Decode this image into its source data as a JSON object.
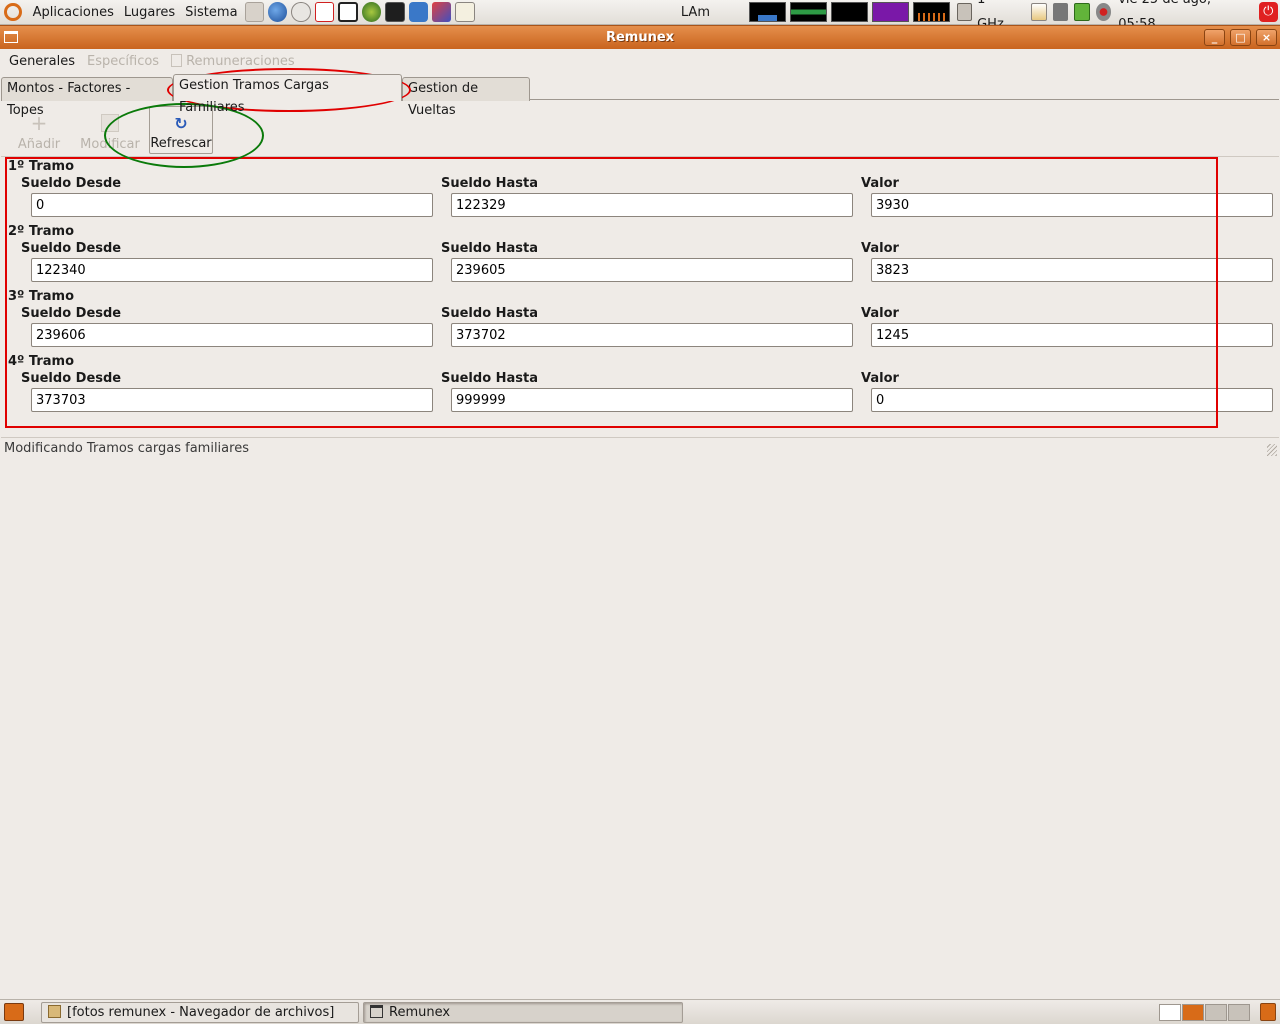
{
  "top_panel": {
    "menus": [
      "Aplicaciones",
      "Lugares",
      "Sistema"
    ],
    "launchers": [
      "pda-icon",
      "firefox-icon",
      "mail-icon",
      "network-icon",
      "inkscape-icon",
      "globe-icon",
      "terminal-icon",
      "network-config-icon",
      "tools-icon",
      "notes-icon"
    ],
    "keyboard_layout": "LAm",
    "cpu_freq": "1 GHz",
    "datetime": "vie 25 de ago, 05:58",
    "colors": {
      "accent": "#d86b18",
      "memory": "#2e9a45",
      "load": "#7a18a8",
      "cpu": "#3a78c8",
      "power": "#e02020"
    }
  },
  "window": {
    "title": "Remunex",
    "controls": {
      "minimize": "_",
      "maximize": "□",
      "close": "×"
    }
  },
  "menubar": {
    "items": [
      {
        "label": "Generales",
        "enabled": true
      },
      {
        "label": "Específicos",
        "enabled": false
      },
      {
        "label": "Remuneraciones",
        "enabled": false
      }
    ]
  },
  "tabs": [
    {
      "label": "Montos - Factores - Topes",
      "active": false
    },
    {
      "label": "Gestion Tramos Cargas Familiares",
      "active": true
    },
    {
      "label": "Gestion de Vueltas",
      "active": false
    }
  ],
  "toolbar": {
    "add_label": "Añadir",
    "modify_label": "Modificar",
    "refresh_label": "Refrescar"
  },
  "form": {
    "col_desde": "Sueldo Desde",
    "col_hasta": "Sueldo Hasta",
    "col_valor": "Valor",
    "tramos": [
      {
        "title": "1º Tramo",
        "desde": "0",
        "hasta": "122329",
        "valor": "3930"
      },
      {
        "title": "2º Tramo",
        "desde": "122340",
        "hasta": "239605",
        "valor": "3823"
      },
      {
        "title": "3º Tramo",
        "desde": "239606",
        "hasta": "373702",
        "valor": "1245"
      },
      {
        "title": "4º Tramo",
        "desde": "373703",
        "hasta": "999999",
        "valor": "0"
      }
    ]
  },
  "statusbar": {
    "message": "Modificando Tramos cargas familiares"
  },
  "taskbar": {
    "tasks": [
      {
        "label": "[fotos remunex - Navegador de archivos]",
        "active": false
      },
      {
        "label": "Remunex",
        "active": true
      }
    ]
  },
  "annotation_colors": {
    "red": "#e00000",
    "green": "#0a7a0a"
  }
}
